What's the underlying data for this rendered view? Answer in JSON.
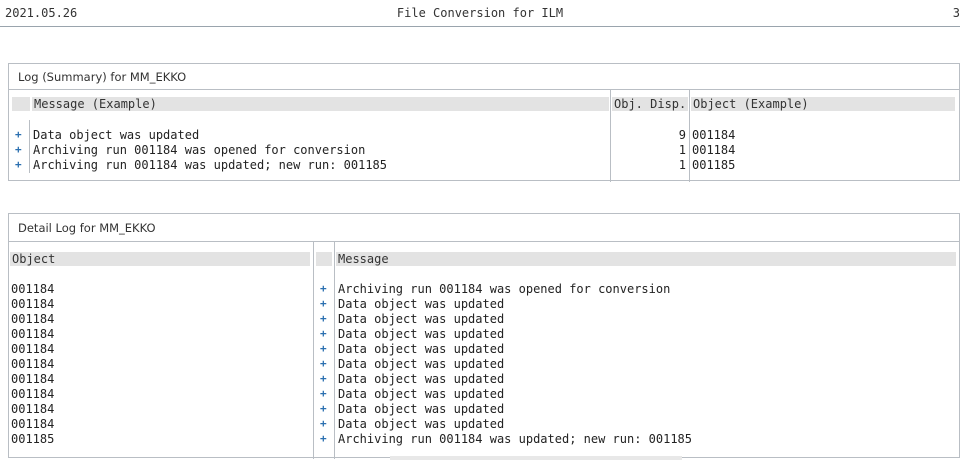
{
  "header": {
    "date": "2021.05.26",
    "title": "File Conversion for ILM",
    "page_number": "3"
  },
  "summary": {
    "title": "Log (Summary) for MM_EKKO",
    "columns": {
      "message": "Message (Example)",
      "disp": "Obj. Disp.",
      "object": "Object (Example)"
    },
    "rows": [
      {
        "message": "Data object was updated",
        "disp": "9",
        "object": "001184"
      },
      {
        "message": "Archiving run 001184 was opened for conversion",
        "disp": "1",
        "object": "001184"
      },
      {
        "message": "Archiving run 001184 was updated; new run: 001185",
        "disp": "1",
        "object": "001185"
      }
    ]
  },
  "detail": {
    "title": "Detail Log for MM_EKKO",
    "columns": {
      "object": "Object",
      "message": "Message"
    },
    "rows": [
      {
        "object": "001184",
        "message": "Archiving run 001184 was opened for conversion"
      },
      {
        "object": "001184",
        "message": "Data object was updated"
      },
      {
        "object": "001184",
        "message": "Data object was updated"
      },
      {
        "object": "001184",
        "message": "Data object was updated"
      },
      {
        "object": "001184",
        "message": "Data object was updated"
      },
      {
        "object": "001184",
        "message": "Data object was updated"
      },
      {
        "object": "001184",
        "message": "Data object was updated"
      },
      {
        "object": "001184",
        "message": "Data object was updated"
      },
      {
        "object": "001184",
        "message": "Data object was updated"
      },
      {
        "object": "001184",
        "message": "Data object was updated"
      },
      {
        "object": "001185",
        "message": "Archiving run 001184 was updated; new run: 001185"
      }
    ]
  },
  "icons": {
    "row_status": "plus-icon",
    "accent_color": "#2a6fb0"
  }
}
